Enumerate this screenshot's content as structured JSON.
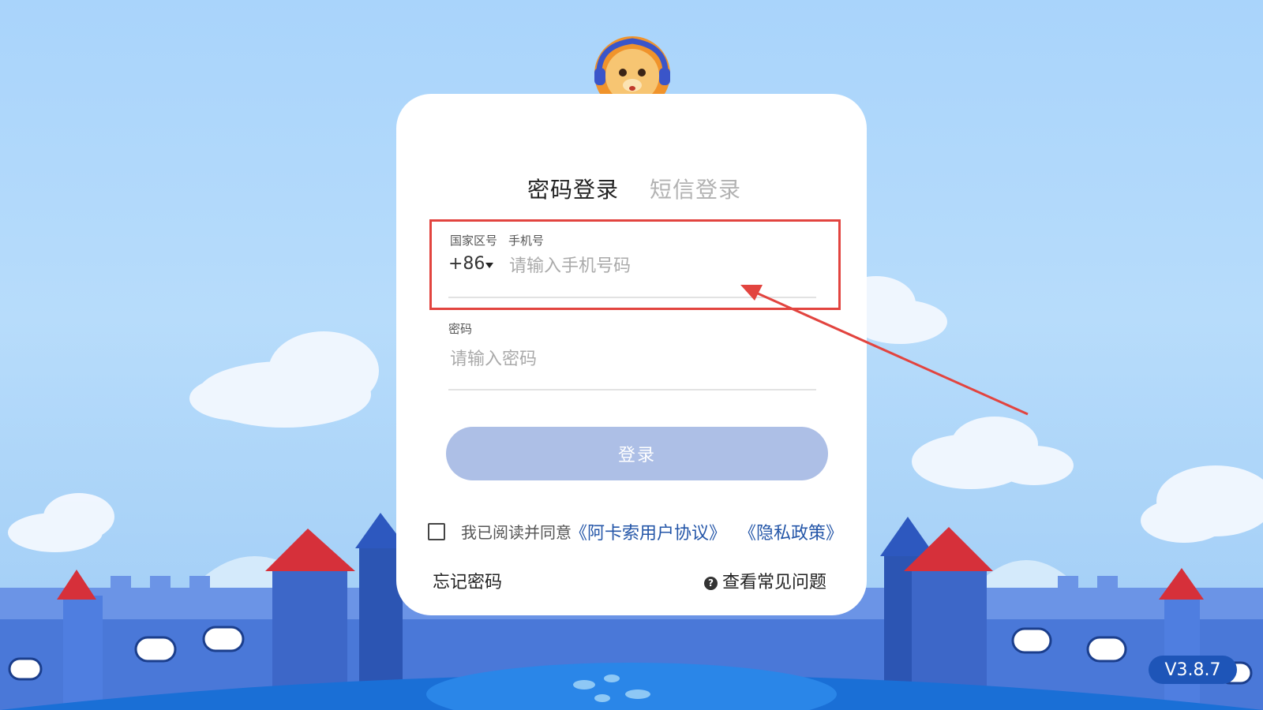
{
  "tabs": {
    "password_login": "密码登录",
    "sms_login": "短信登录"
  },
  "phone": {
    "country_label": "国家区号",
    "number_label": "手机号",
    "country_code": "+86",
    "placeholder": "请输入手机号码",
    "value": ""
  },
  "password": {
    "label": "密码",
    "placeholder": "请输入密码",
    "value": ""
  },
  "login_button": "登录",
  "agreement": {
    "checked": false,
    "text": "我已阅读并同意",
    "terms_link": "《阿卡索用户协议》",
    "privacy_link": "《隐私政策》"
  },
  "footer": {
    "forgot_password": "忘记密码",
    "faq": "查看常见问题"
  },
  "version": "V3.8.7",
  "colors": {
    "primary_button": "#adbfe6",
    "link": "#2456a8",
    "highlight": "#e2443f",
    "version_badge": "#1e55b8"
  },
  "icons": {
    "mascot": "lion-mascot-icon",
    "dropdown": "caret-down-icon",
    "faq": "question-circle-icon"
  }
}
